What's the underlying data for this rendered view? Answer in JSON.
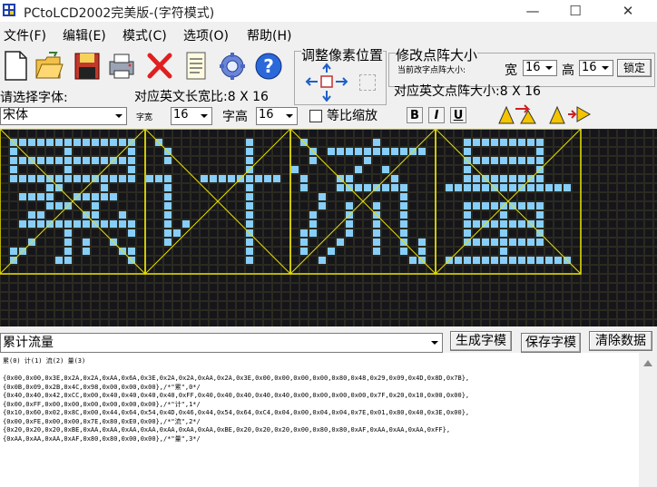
{
  "window": {
    "title": "PCtoLCD2002完美版-(字符模式)",
    "minimize": "—",
    "maximize": "☐",
    "close": "✕"
  },
  "menu": [
    {
      "label": "文件(F)"
    },
    {
      "label": "编辑(E)"
    },
    {
      "label": "模式(C)"
    },
    {
      "label": "选项(O)"
    },
    {
      "label": "帮助(H)"
    }
  ],
  "toolbar": {
    "icons": [
      "new-file-icon",
      "open-folder-icon",
      "save-disk-icon",
      "print-icon",
      "delete-icon",
      "notepad-icon",
      "settings-gear-icon",
      "help-icon"
    ],
    "adjust_pixel_group": "调整像素位置",
    "dot_size_group": "修改点阵大小",
    "current_dot_size_label": "当前改字点阵大小:",
    "width_label": "宽",
    "width_value": "16",
    "height_label": "高",
    "height_value": "16",
    "lock_button": "锁定",
    "select_font_label": "请选择字体:",
    "english_ratio_label": "对应英文长宽比:8 X 16",
    "english_dot_size_label": "对应英文点阵大小:8 X 16",
    "font_value": "宋体",
    "char_width_label": "字宽",
    "char_width_value": "16",
    "char_height_label": "字高",
    "char_height_value": "16",
    "scale_checkbox_label": "等比缩放",
    "bold_label": "B",
    "italic_label": "I",
    "underline_label": "U"
  },
  "grid": {
    "cell_count_note": "",
    "on_color": "#87cefa",
    "off_color": "#15151a",
    "bg_color": "#2a2a20",
    "frame_color": "#e8e000",
    "glyphs": [
      [
        "0000000000000000",
        "0111111111111110",
        "0100000100000010",
        "0111111111111110",
        "0100000100000010",
        "0111111111111110",
        "0000011000010000",
        "0011110011111000",
        "0000011100100000",
        "0001100001100100",
        "0011111111111110",
        "0000000100000010",
        "0001000101001000",
        "0110000101000110",
        "0100001100000010",
        "0000000000000000"
      ],
      [
        "0000000000000000",
        "0100000000010000",
        "0010000000010000",
        "0010000000010000",
        "0000000000010000",
        "1110001111111110",
        "0010000000010000",
        "0010000000010000",
        "0010000000010000",
        "0010000000010000",
        "0010100000010000",
        "0011000000010000",
        "0010000000010000",
        "0000000000010000",
        "0000000000010000",
        "0000000000000000"
      ],
      [
        "0000000000000000",
        "0100000001000000",
        "0010111111111110",
        "0010000010000000",
        "1000000100100000",
        "0100011000010000",
        "0100011111111000",
        "0001000000001000",
        "0001001001001000",
        "0010001001001000",
        "0010001001001000",
        "0110001001001000",
        "0100010001001010",
        "0100100001001010",
        "0001000000000110",
        "0000000000000000"
      ],
      [
        "0000000000000000",
        "0001111111110000",
        "0001000000010000",
        "0001111111110000",
        "0001000000010000",
        "0001111111110000",
        "0111111111111110",
        "0000000000000000",
        "0001111111110000",
        "0001000100010000",
        "0001111111110000",
        "0001000100010000",
        "0001111111110000",
        "0000000100000000",
        "0111111111111110",
        "0000000000000000"
      ]
    ]
  },
  "input": {
    "text": "累计流量",
    "generate_button": "生成字模",
    "save_button": "保存字模",
    "clear_button": "清除数据"
  },
  "output": {
    "header": "累(0) 计(1) 流(2) 量(3)",
    "lines": [
      "{0x00,0x00,0x3E,0x2A,0x2A,0xAA,0x6A,0x3E,0x2A,0x2A,0xAA,0x2A,0x3E,0x00,0x00,0x00,0x00,0x80,0x48,0x29,0x09,0x4D,0x8D,0x7B},",
      "{0x0B,0x09,0x2B,0x4C,0x98,0x00,0x00,0x00},/*\"累\",0*/",
      "{0x40,0x40,0x42,0xCC,0x00,0x40,0x40,0x40,0x40,0xFF,0x40,0x40,0x40,0x40,0x40,0x00,0x00,0x00,0x00,0x7F,0x20,0x10,0x00,0x00},",
      "{0x00,0xFF,0x00,0x00,0x00,0x00,0x00,0x00},/*\"计\",1*/",
      "{0x10,0x60,0x02,0x8C,0x00,0x44,0x64,0x54,0x4D,0x46,0x44,0x54,0x64,0xC4,0x04,0x00,0x04,0x04,0x7E,0x01,0x80,0x40,0x3E,0x00},",
      "{0x00,0xFE,0x00,0x00,0x7E,0x80,0xE0,0x00},/*\"流\",2*/",
      "{0x20,0x20,0x20,0xBE,0xAA,0xAA,0xAA,0xAA,0xAA,0xAA,0xAA,0xBE,0x20,0x20,0x20,0x00,0x80,0x80,0xAF,0xAA,0xAA,0xAA,0xFF},",
      "{0xAA,0xAA,0xAA,0xAF,0x80,0x80,0x00,0x00},/*\"量\",3*/"
    ]
  }
}
